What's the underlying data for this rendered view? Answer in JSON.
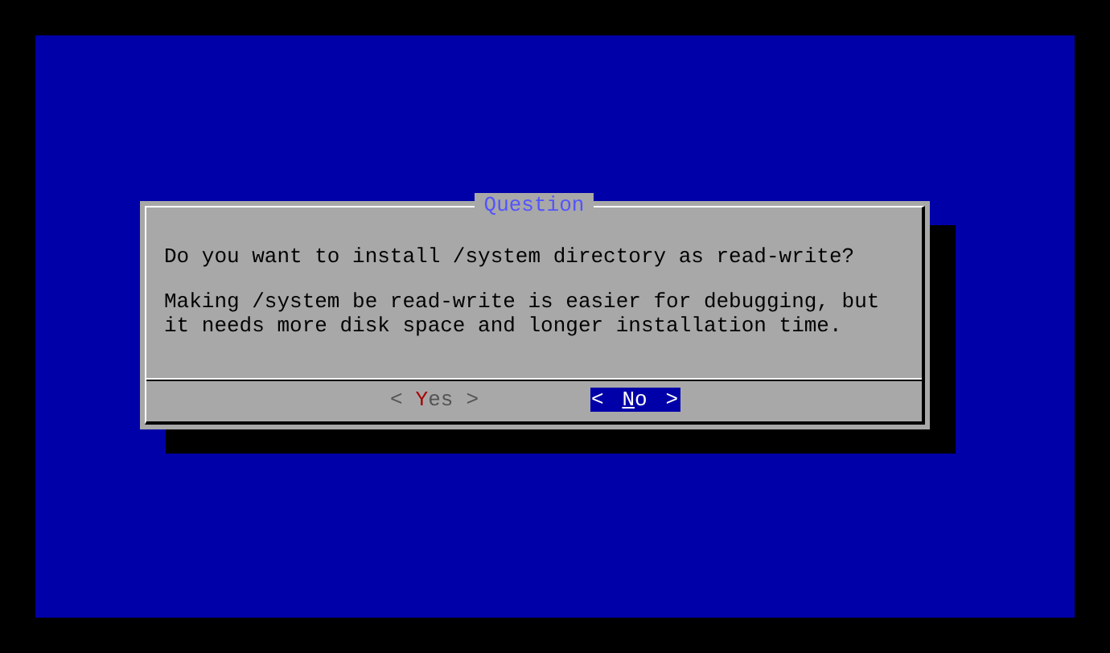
{
  "dialog": {
    "title": "Question",
    "question": "Do you want to install /system directory as read-write?",
    "message": "Making /system be read-write is easier for debugging, but it needs more disk space and longer installation time.",
    "buttons": [
      {
        "left": "<",
        "label": "Yes",
        "right": ">",
        "selected": false
      },
      {
        "left": "<",
        "label": "No",
        "right": ">",
        "selected": true
      }
    ]
  }
}
